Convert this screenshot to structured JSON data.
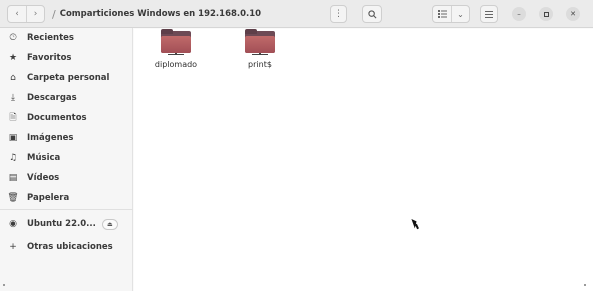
{
  "window": {
    "path_label": "Comparticiones Windows en 192.168.0.10",
    "path_separator": "/"
  },
  "headerbar": {
    "back_icon": "chevron-left-icon",
    "forward_icon": "chevron-right-icon",
    "menu_icon": "vertical-dots-icon",
    "search_icon": "search-icon",
    "view_list_icon": "list-view-icon",
    "view_dropdown_icon": "chevron-down-icon",
    "hamburger_icon": "hamburger-menu-icon"
  },
  "sidebar": {
    "items": [
      {
        "label": "Recientes",
        "icon": "clock-icon"
      },
      {
        "label": "Favoritos",
        "icon": "star-icon"
      },
      {
        "label": "Carpeta personal",
        "icon": "home-icon"
      },
      {
        "label": "Descargas",
        "icon": "download-icon"
      },
      {
        "label": "Documentos",
        "icon": "document-icon"
      },
      {
        "label": "Imágenes",
        "icon": "image-icon"
      },
      {
        "label": "Música",
        "icon": "music-icon"
      },
      {
        "label": "Vídeos",
        "icon": "video-icon"
      },
      {
        "label": "Papelera",
        "icon": "trash-icon"
      },
      {
        "label": "Ubuntu 22.0...",
        "icon": "disc-icon"
      },
      {
        "label": "Otras ubicaciones",
        "icon": "plus-icon"
      }
    ]
  },
  "content": {
    "files": [
      {
        "name": "diplomado",
        "icon": "network-folder-icon"
      },
      {
        "name": "print$",
        "icon": "network-folder-icon"
      }
    ]
  },
  "colors": {
    "folder_front": "#b05c60",
    "folder_back": "#6d4a55",
    "headerbar_bg": "#ebebeb",
    "sidebar_bg": "#f6f6f6"
  }
}
